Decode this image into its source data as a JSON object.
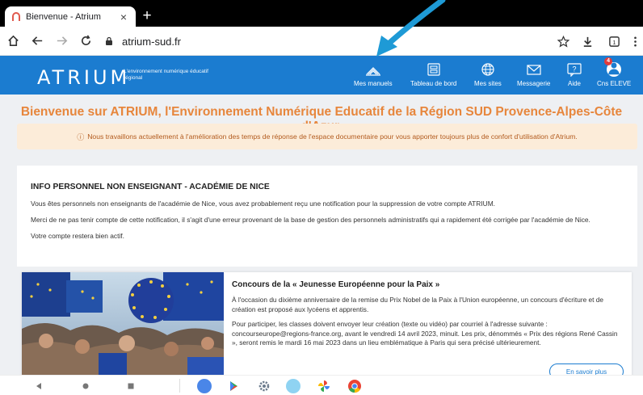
{
  "browser": {
    "tab_title": "Bienvenue - Atrium",
    "tab_close": "×",
    "new_tab": "+",
    "url": "atrium-sud.fr"
  },
  "header": {
    "logo": "ATRIUM",
    "logo_sub": "L'environnement numérique éducatif régional",
    "nav": [
      {
        "label": "Mes manuels",
        "icon": "books-icon"
      },
      {
        "label": "Tableau de bord",
        "icon": "dashboard-icon"
      },
      {
        "label": "Mes sites",
        "icon": "globe-icon"
      },
      {
        "label": "Messagerie",
        "icon": "mail-icon"
      },
      {
        "label": "Aide",
        "icon": "help-icon"
      },
      {
        "label": "Cns ELEVE",
        "icon": "user-avatar-icon",
        "badge": "4"
      }
    ]
  },
  "welcome": "Bienvenue sur ATRIUM, l'Environnement Numérique Educatif de la Région SUD Provence-Alpes-Côte d'Azur.",
  "notice": "Nous travaillons actuellement à l'amélioration des temps de réponse de l'espace documentaire pour vous apporter toujours plus de confort d'utilisation d'Atrium.",
  "info": {
    "title": "INFO PERSONNEL NON ENSEIGNANT - ACADÉMIE DE NICE",
    "p1": "Vous êtes personnels non enseignants de l'académie de Nice, vous avez probablement reçu une notification pour la suppression de votre compte ATRIUM.",
    "p2": "Merci de ne pas tenir compte de cette notification, il s'agit d'une erreur provenant de la base de gestion des personnels administratifs qui a rapidement été corrigée par l'académie de Nice.",
    "p3": "Votre compte restera bien actif."
  },
  "news": {
    "title": "Concours de la « Jeunesse Européenne pour la Paix »",
    "p1": "À l'occasion du dixième anniversaire de la remise du Prix Nobel de la Paix à l'Union européenne, un concours d'écriture et de création est proposé aux lycéens et apprentis.",
    "p2": "Pour participer, les classes doivent envoyer leur création (texte ou vidéo) par courriel à l'adresse suivante : concourseurope@regions-france.org, avant le vendredi 14 avril 2023, minuit. Les prix, dénommés « Prix des régions René Cassin », seront remis le mardi 16 mai 2023 dans un lieu emblématique à Paris qui sera précisé ultérieurement.",
    "button": "En savoir plus"
  },
  "colors": {
    "header_blue": "#1b7cd0",
    "welcome_orange": "#e7863c",
    "notice_bg": "#fcecd9",
    "arrow": "#1e9ad6"
  }
}
